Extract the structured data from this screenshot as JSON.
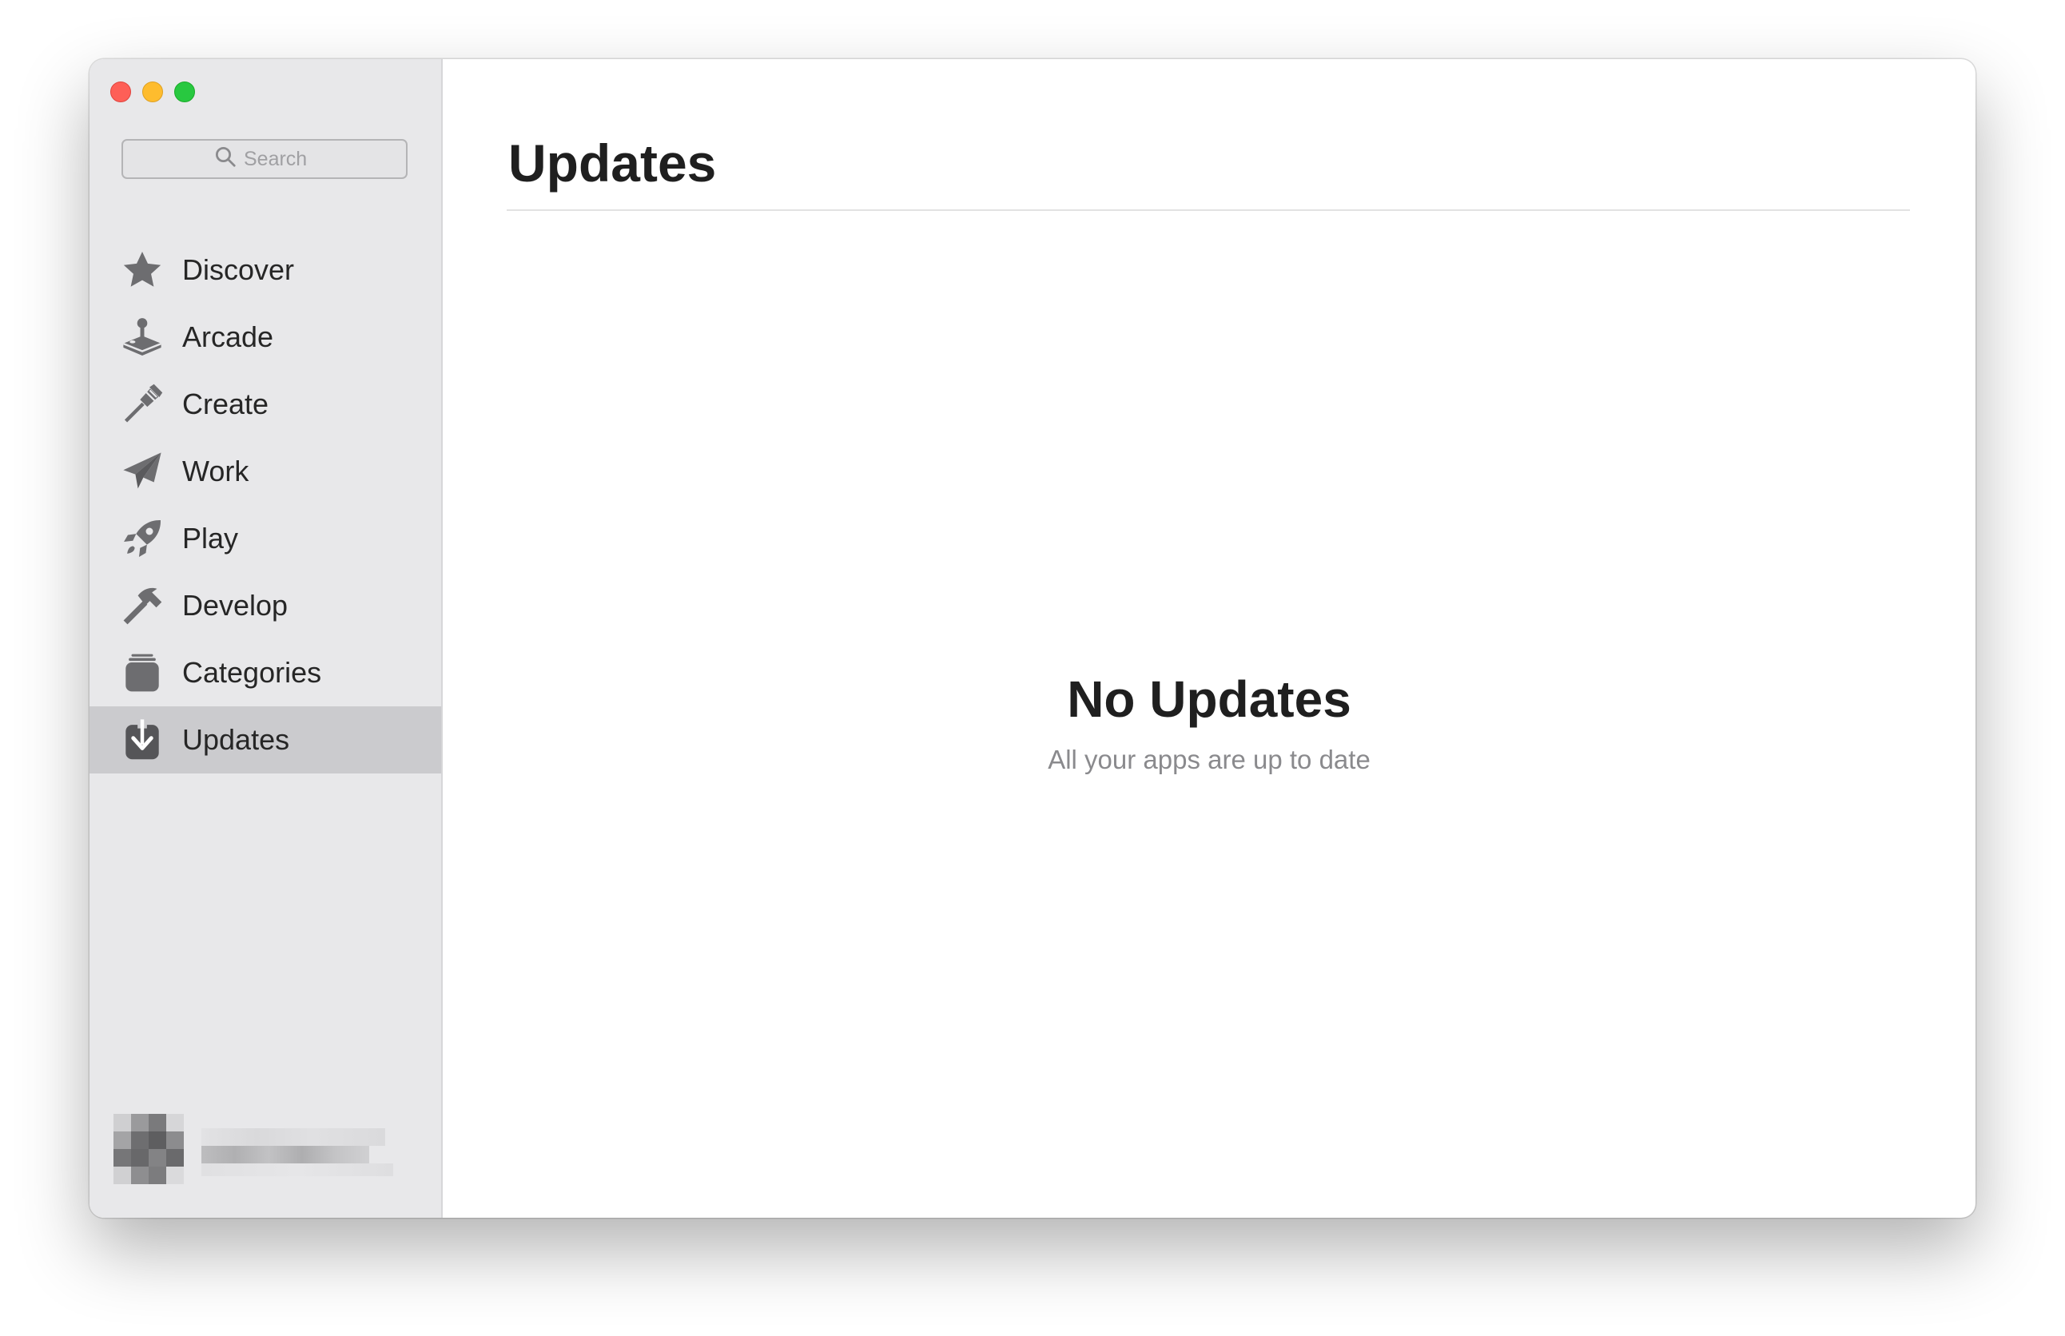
{
  "window": {
    "controls": [
      "close",
      "minimize",
      "maximize"
    ]
  },
  "sidebar": {
    "search": {
      "placeholder": "Search",
      "value": "",
      "icon": "search-icon"
    },
    "items": [
      {
        "label": "Discover",
        "icon": "star-icon",
        "selected": false
      },
      {
        "label": "Arcade",
        "icon": "joystick-icon",
        "selected": false
      },
      {
        "label": "Create",
        "icon": "paintbrush-icon",
        "selected": false
      },
      {
        "label": "Work",
        "icon": "paper-plane-icon",
        "selected": false
      },
      {
        "label": "Play",
        "icon": "rocket-icon",
        "selected": false
      },
      {
        "label": "Develop",
        "icon": "hammer-icon",
        "selected": false
      },
      {
        "label": "Categories",
        "icon": "stack-icon",
        "selected": false
      },
      {
        "label": "Updates",
        "icon": "download-icon",
        "selected": true
      }
    ],
    "account": {
      "avatar": "pixelated-avatar",
      "name_obscured": true
    }
  },
  "main": {
    "title": "Updates",
    "empty_state": {
      "title": "No Updates",
      "subtitle": "All your apps are up to date"
    }
  },
  "colors": {
    "sidebar_bg": "#e8e8ea",
    "selected_bg": "#cbcbce",
    "icon_gray": "#6d6d70",
    "text_primary": "#1f1f1f",
    "text_secondary": "#8a8a8d",
    "close": "#fe5f57",
    "minimize": "#febc2e",
    "maximize": "#28c840"
  }
}
